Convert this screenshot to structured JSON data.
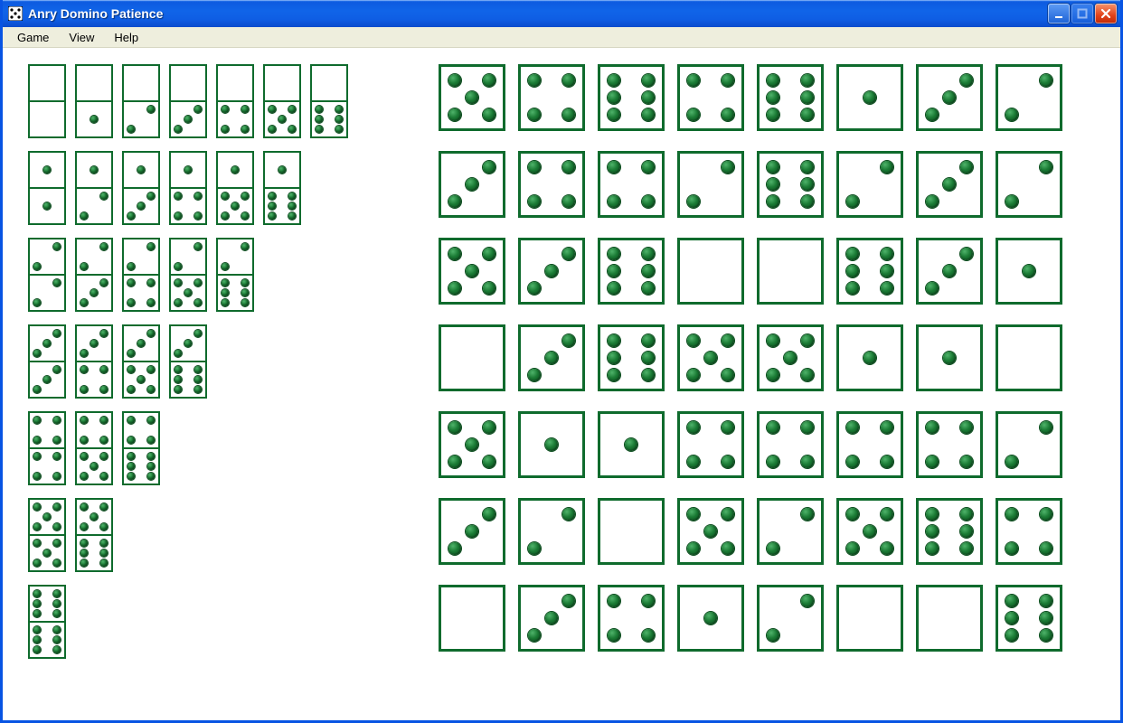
{
  "window": {
    "title": "Anry Domino Patience"
  },
  "menu": {
    "items": [
      "Game",
      "View",
      "Help"
    ]
  },
  "colors": {
    "pip": "#1a7a34",
    "tile_border": "#0f6b2d",
    "titlebar_start": "#3f89f3",
    "titlebar_end": "#0a4bcc",
    "menubar_bg": "#eeeedd"
  },
  "dominoes": {
    "rows": [
      [
        [
          0,
          0
        ],
        [
          0,
          1
        ],
        [
          0,
          2
        ],
        [
          0,
          3
        ],
        [
          0,
          4
        ],
        [
          0,
          5
        ],
        [
          0,
          6
        ]
      ],
      [
        [
          1,
          1
        ],
        [
          1,
          2
        ],
        [
          1,
          3
        ],
        [
          1,
          4
        ],
        [
          1,
          5
        ],
        [
          1,
          6
        ]
      ],
      [
        [
          2,
          2
        ],
        [
          2,
          3
        ],
        [
          2,
          4
        ],
        [
          2,
          5
        ],
        [
          2,
          6
        ]
      ],
      [
        [
          3,
          3
        ],
        [
          3,
          4
        ],
        [
          3,
          5
        ],
        [
          3,
          6
        ]
      ],
      [
        [
          4,
          4
        ],
        [
          4,
          5
        ],
        [
          4,
          6
        ]
      ],
      [
        [
          5,
          5
        ],
        [
          5,
          6
        ]
      ],
      [
        [
          6,
          6
        ]
      ]
    ]
  },
  "board": {
    "rows": [
      [
        5,
        4,
        6,
        4,
        6,
        1,
        3,
        2
      ],
      [
        3,
        4,
        4,
        2,
        6,
        2,
        3,
        2
      ],
      [
        5,
        3,
        6,
        0,
        0,
        6,
        3,
        1
      ],
      [
        0,
        3,
        6,
        5,
        5,
        1,
        1,
        0
      ],
      [
        5,
        1,
        1,
        4,
        4,
        4,
        4,
        2
      ],
      [
        3,
        2,
        0,
        5,
        2,
        5,
        6,
        4
      ],
      [
        0,
        3,
        4,
        1,
        2,
        0,
        0,
        6
      ]
    ]
  }
}
